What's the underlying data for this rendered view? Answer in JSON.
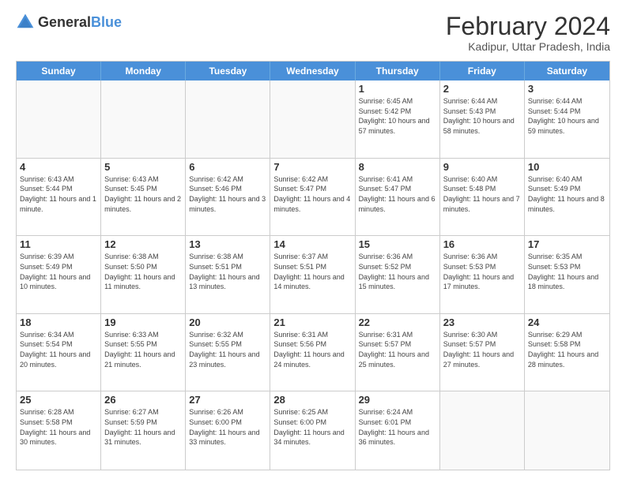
{
  "header": {
    "logo": {
      "text_general": "General",
      "text_blue": "Blue"
    },
    "title": "February 2024",
    "location": "Kadipur, Uttar Pradesh, India"
  },
  "days_of_week": [
    "Sunday",
    "Monday",
    "Tuesday",
    "Wednesday",
    "Thursday",
    "Friday",
    "Saturday"
  ],
  "weeks": [
    [
      {
        "day": "",
        "sunrise": "",
        "sunset": "",
        "daylight": "",
        "empty": true
      },
      {
        "day": "",
        "sunrise": "",
        "sunset": "",
        "daylight": "",
        "empty": true
      },
      {
        "day": "",
        "sunrise": "",
        "sunset": "",
        "daylight": "",
        "empty": true
      },
      {
        "day": "",
        "sunrise": "",
        "sunset": "",
        "daylight": "",
        "empty": true
      },
      {
        "day": "1",
        "sunrise": "Sunrise: 6:45 AM",
        "sunset": "Sunset: 5:42 PM",
        "daylight": "Daylight: 10 hours and 57 minutes.",
        "empty": false
      },
      {
        "day": "2",
        "sunrise": "Sunrise: 6:44 AM",
        "sunset": "Sunset: 5:43 PM",
        "daylight": "Daylight: 10 hours and 58 minutes.",
        "empty": false
      },
      {
        "day": "3",
        "sunrise": "Sunrise: 6:44 AM",
        "sunset": "Sunset: 5:44 PM",
        "daylight": "Daylight: 10 hours and 59 minutes.",
        "empty": false
      }
    ],
    [
      {
        "day": "4",
        "sunrise": "Sunrise: 6:43 AM",
        "sunset": "Sunset: 5:44 PM",
        "daylight": "Daylight: 11 hours and 1 minute.",
        "empty": false
      },
      {
        "day": "5",
        "sunrise": "Sunrise: 6:43 AM",
        "sunset": "Sunset: 5:45 PM",
        "daylight": "Daylight: 11 hours and 2 minutes.",
        "empty": false
      },
      {
        "day": "6",
        "sunrise": "Sunrise: 6:42 AM",
        "sunset": "Sunset: 5:46 PM",
        "daylight": "Daylight: 11 hours and 3 minutes.",
        "empty": false
      },
      {
        "day": "7",
        "sunrise": "Sunrise: 6:42 AM",
        "sunset": "Sunset: 5:47 PM",
        "daylight": "Daylight: 11 hours and 4 minutes.",
        "empty": false
      },
      {
        "day": "8",
        "sunrise": "Sunrise: 6:41 AM",
        "sunset": "Sunset: 5:47 PM",
        "daylight": "Daylight: 11 hours and 6 minutes.",
        "empty": false
      },
      {
        "day": "9",
        "sunrise": "Sunrise: 6:40 AM",
        "sunset": "Sunset: 5:48 PM",
        "daylight": "Daylight: 11 hours and 7 minutes.",
        "empty": false
      },
      {
        "day": "10",
        "sunrise": "Sunrise: 6:40 AM",
        "sunset": "Sunset: 5:49 PM",
        "daylight": "Daylight: 11 hours and 8 minutes.",
        "empty": false
      }
    ],
    [
      {
        "day": "11",
        "sunrise": "Sunrise: 6:39 AM",
        "sunset": "Sunset: 5:49 PM",
        "daylight": "Daylight: 11 hours and 10 minutes.",
        "empty": false
      },
      {
        "day": "12",
        "sunrise": "Sunrise: 6:38 AM",
        "sunset": "Sunset: 5:50 PM",
        "daylight": "Daylight: 11 hours and 11 minutes.",
        "empty": false
      },
      {
        "day": "13",
        "sunrise": "Sunrise: 6:38 AM",
        "sunset": "Sunset: 5:51 PM",
        "daylight": "Daylight: 11 hours and 13 minutes.",
        "empty": false
      },
      {
        "day": "14",
        "sunrise": "Sunrise: 6:37 AM",
        "sunset": "Sunset: 5:51 PM",
        "daylight": "Daylight: 11 hours and 14 minutes.",
        "empty": false
      },
      {
        "day": "15",
        "sunrise": "Sunrise: 6:36 AM",
        "sunset": "Sunset: 5:52 PM",
        "daylight": "Daylight: 11 hours and 15 minutes.",
        "empty": false
      },
      {
        "day": "16",
        "sunrise": "Sunrise: 6:36 AM",
        "sunset": "Sunset: 5:53 PM",
        "daylight": "Daylight: 11 hours and 17 minutes.",
        "empty": false
      },
      {
        "day": "17",
        "sunrise": "Sunrise: 6:35 AM",
        "sunset": "Sunset: 5:53 PM",
        "daylight": "Daylight: 11 hours and 18 minutes.",
        "empty": false
      }
    ],
    [
      {
        "day": "18",
        "sunrise": "Sunrise: 6:34 AM",
        "sunset": "Sunset: 5:54 PM",
        "daylight": "Daylight: 11 hours and 20 minutes.",
        "empty": false
      },
      {
        "day": "19",
        "sunrise": "Sunrise: 6:33 AM",
        "sunset": "Sunset: 5:55 PM",
        "daylight": "Daylight: 11 hours and 21 minutes.",
        "empty": false
      },
      {
        "day": "20",
        "sunrise": "Sunrise: 6:32 AM",
        "sunset": "Sunset: 5:55 PM",
        "daylight": "Daylight: 11 hours and 23 minutes.",
        "empty": false
      },
      {
        "day": "21",
        "sunrise": "Sunrise: 6:31 AM",
        "sunset": "Sunset: 5:56 PM",
        "daylight": "Daylight: 11 hours and 24 minutes.",
        "empty": false
      },
      {
        "day": "22",
        "sunrise": "Sunrise: 6:31 AM",
        "sunset": "Sunset: 5:57 PM",
        "daylight": "Daylight: 11 hours and 25 minutes.",
        "empty": false
      },
      {
        "day": "23",
        "sunrise": "Sunrise: 6:30 AM",
        "sunset": "Sunset: 5:57 PM",
        "daylight": "Daylight: 11 hours and 27 minutes.",
        "empty": false
      },
      {
        "day": "24",
        "sunrise": "Sunrise: 6:29 AM",
        "sunset": "Sunset: 5:58 PM",
        "daylight": "Daylight: 11 hours and 28 minutes.",
        "empty": false
      }
    ],
    [
      {
        "day": "25",
        "sunrise": "Sunrise: 6:28 AM",
        "sunset": "Sunset: 5:58 PM",
        "daylight": "Daylight: 11 hours and 30 minutes.",
        "empty": false
      },
      {
        "day": "26",
        "sunrise": "Sunrise: 6:27 AM",
        "sunset": "Sunset: 5:59 PM",
        "daylight": "Daylight: 11 hours and 31 minutes.",
        "empty": false
      },
      {
        "day": "27",
        "sunrise": "Sunrise: 6:26 AM",
        "sunset": "Sunset: 6:00 PM",
        "daylight": "Daylight: 11 hours and 33 minutes.",
        "empty": false
      },
      {
        "day": "28",
        "sunrise": "Sunrise: 6:25 AM",
        "sunset": "Sunset: 6:00 PM",
        "daylight": "Daylight: 11 hours and 34 minutes.",
        "empty": false
      },
      {
        "day": "29",
        "sunrise": "Sunrise: 6:24 AM",
        "sunset": "Sunset: 6:01 PM",
        "daylight": "Daylight: 11 hours and 36 minutes.",
        "empty": false
      },
      {
        "day": "",
        "sunrise": "",
        "sunset": "",
        "daylight": "",
        "empty": true
      },
      {
        "day": "",
        "sunrise": "",
        "sunset": "",
        "daylight": "",
        "empty": true
      }
    ]
  ],
  "colors": {
    "header_bg": "#4a90d9",
    "accent": "#4a90d9"
  }
}
